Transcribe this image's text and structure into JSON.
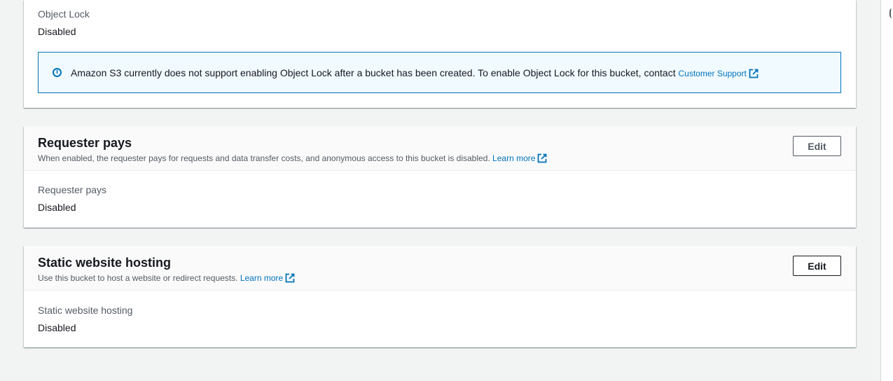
{
  "object_lock": {
    "label": "Object Lock",
    "value": "Disabled",
    "info_text": "Amazon S3 currently does not support enabling Object Lock after a bucket has been created. To enable Object Lock for this bucket, contact",
    "info_link": "Customer Support",
    "info_icon": "info-icon"
  },
  "requester_pays": {
    "title": "Requester pays",
    "description": "When enabled, the requester pays for requests and data transfer costs, and anonymous access to this bucket is disabled.",
    "learn_more": "Learn more",
    "edit_label": "Edit",
    "field_label": "Requester pays",
    "field_value": "Disabled"
  },
  "static_website": {
    "title": "Static website hosting",
    "description": "Use this bucket to host a website or redirect requests.",
    "learn_more": "Learn more",
    "edit_label": "Edit",
    "field_label": "Static website hosting",
    "field_value": "Disabled"
  },
  "colors": {
    "link": "#0073bb",
    "info_bg": "#f1faff",
    "text": "#16191f",
    "muted": "#545b64"
  }
}
